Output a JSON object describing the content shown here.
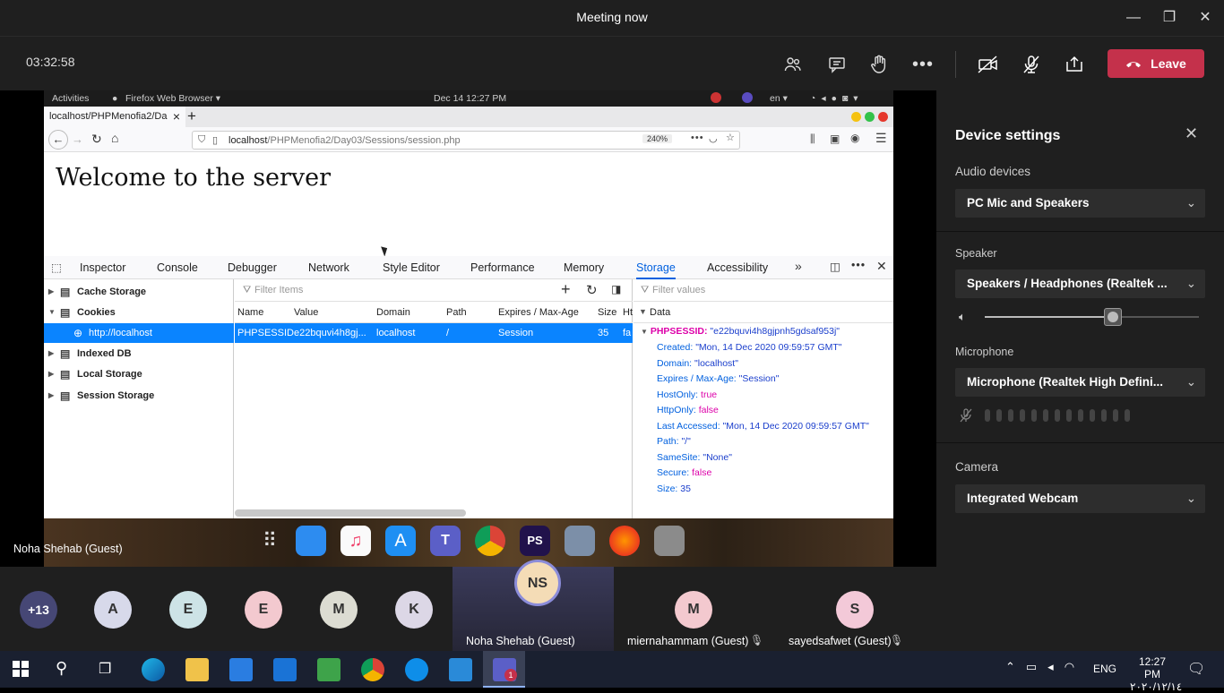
{
  "window": {
    "title": "Meeting now",
    "minimize": "—",
    "restore": "❐",
    "close": "✕"
  },
  "call": {
    "timer": "03:32:58",
    "leave_label": "Leave"
  },
  "shared_screen": {
    "gnome": {
      "activities": "Activities",
      "app": "Firefox Web Browser ▾",
      "clock": "Dec 14  12:27 PM",
      "lang": "en ▾"
    },
    "tab": {
      "title": "localhost/PHPMenofia2/Da",
      "close": "×",
      "new": "+"
    },
    "url": {
      "host": "localhost",
      "path": "/PHPMenofia2/Day03/Sessions/session.php",
      "zoom": "240%"
    },
    "page_heading": "Welcome to the server",
    "devtools": {
      "tabs": [
        "Inspector",
        "Console",
        "Debugger",
        "Network",
        "Style Editor",
        "Performance",
        "Memory",
        "Storage",
        "Accessibility"
      ],
      "active_tab": "Storage",
      "tree": [
        "Cache Storage",
        "Cookies",
        "http://localhost",
        "Indexed DB",
        "Local Storage",
        "Session Storage"
      ],
      "filter_items_placeholder": "Filter Items",
      "filter_values_placeholder": "Filter values",
      "columns": [
        "Name",
        "Value",
        "Domain",
        "Path",
        "Expires / Max-Age",
        "Size",
        "Ht"
      ],
      "row": [
        "PHPSESSID",
        "e22bquvi4h8gj...",
        "localhost",
        "/",
        "Session",
        "35",
        "fa"
      ],
      "data_header": "Data",
      "data_root_key": "PHPSESSID:",
      "data_root_val": "\"e22bquvi4h8gjpnh5gdsaf953j\"",
      "data": [
        {
          "k": "Created:",
          "v": "\"Mon, 14 Dec 2020 09:59:57 GMT\"",
          "t": "str"
        },
        {
          "k": "Domain:",
          "v": "\"localhost\"",
          "t": "str"
        },
        {
          "k": "Expires / Max-Age:",
          "v": "\"Session\"",
          "t": "str"
        },
        {
          "k": "HostOnly:",
          "v": "true",
          "t": "bool"
        },
        {
          "k": "HttpOnly:",
          "v": "false",
          "t": "bool"
        },
        {
          "k": "Last Accessed:",
          "v": "\"Mon, 14 Dec 2020 09:59:57 GMT\"",
          "t": "str"
        },
        {
          "k": "Path:",
          "v": "\"/\"",
          "t": "str"
        },
        {
          "k": "SameSite:",
          "v": "\"None\"",
          "t": "str"
        },
        {
          "k": "Secure:",
          "v": "false",
          "t": "bool"
        },
        {
          "k": "Size:",
          "v": "35",
          "t": "str"
        }
      ]
    },
    "presenter": "Noha Shehab (Guest)"
  },
  "settings": {
    "title": "Device settings",
    "audio_label": "Audio devices",
    "audio_value": "PC Mic and Speakers",
    "speaker_label": "Speaker",
    "speaker_value": "Speakers / Headphones (Realtek ...",
    "speaker_volume": 0.6,
    "mic_label": "Microphone",
    "mic_value": "Microphone (Realtek High Defini...",
    "camera_label": "Camera",
    "camera_value": "Integrated Webcam"
  },
  "participants": {
    "overflow": "+13",
    "avatars": [
      "A",
      "E",
      "E",
      "M",
      "K"
    ],
    "featured": [
      {
        "initials": "NS",
        "name": "Noha Shehab (Guest)"
      },
      {
        "initials": "M",
        "name": "miernahammam (Guest)"
      },
      {
        "initials": "S",
        "name": "sayedsafwet (Guest)"
      }
    ]
  },
  "taskbar": {
    "lang": "ENG",
    "time": "12:27 PM",
    "date": "٢٠٢٠/١٢/١٤",
    "teams_badge": "1"
  }
}
